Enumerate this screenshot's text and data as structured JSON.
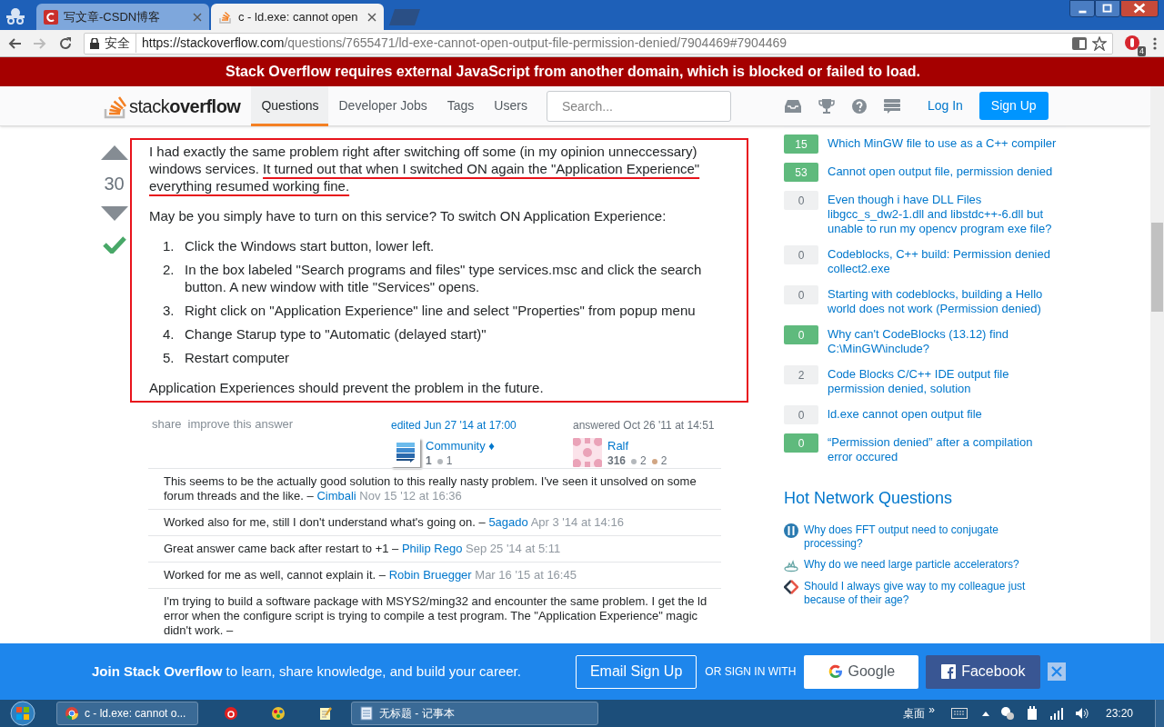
{
  "browser": {
    "tabs": [
      {
        "title": "写文章-CSDN博客",
        "selected": false,
        "kind": "csdn"
      },
      {
        "title": "c - ld.exe: cannot open",
        "selected": true,
        "kind": "so"
      }
    ],
    "address": {
      "secure_label": "安全",
      "host": "https://stackoverflow.com",
      "path": "/questions/7655471/ld-exe-cannot-open-output-file-permission-denied/7904469#7904469"
    },
    "extension_badge": "4"
  },
  "js_warning": "Stack Overflow requires external JavaScript from another domain, which is blocked or failed to load.",
  "header": {
    "logo": {
      "light": "stack",
      "bold": "overflow"
    },
    "nav": [
      {
        "label": "Questions",
        "selected": true
      },
      {
        "label": "Developer Jobs",
        "selected": false
      },
      {
        "label": "Tags",
        "selected": false
      },
      {
        "label": "Users",
        "selected": false
      }
    ],
    "search": {
      "placeholder": "Search..."
    },
    "login": "Log In",
    "signup": "Sign Up"
  },
  "answer": {
    "votes": "30",
    "accepted": true,
    "intro": [
      {
        "text": "I had exactly the same problem right after switching off some (in my opinion unneccessary) windows services. ",
        "underlined": false
      },
      {
        "text": "It turned out that when I switched ON again the \"Application Experience\" everything resumed working fine.",
        "underlined": true
      }
    ],
    "question": "May be you simply have to turn on this service? To switch ON Application Experience:",
    "steps": [
      {
        "number": "1.",
        "text": "Click the Windows start button, lower left."
      },
      {
        "number": "2.",
        "text": "In the box labeled \"Search programs and files\" type services.msc and click the search button. A new window with title \"Services\" opens."
      },
      {
        "number": "3.",
        "text": "Right click on \"Application Experience\" line and select \"Properties\" from popup menu"
      },
      {
        "number": "4.",
        "text": "Change Starup type to \"Automatic (delayed start)\""
      },
      {
        "number": "5.",
        "text": "Restart computer"
      }
    ],
    "closing": "Application Experiences should prevent the problem in the future.",
    "links": [
      "share",
      "improve this answer"
    ],
    "edited": {
      "label": "edited Jun 27 '14 at 17:00",
      "user": "Community ♦",
      "rep": "1",
      "badges": [
        {
          "count": "1",
          "color": "#b4b8bc"
        }
      ],
      "avatar": {
        "kind": "community"
      }
    },
    "answered": {
      "label": "answered Oct 26 '11 at 14:51",
      "user": "Ralf",
      "rep": "316",
      "badges": [
        {
          "count": "2",
          "color": "#b4b8bc"
        },
        {
          "count": "2",
          "color": "#d1a684"
        }
      ],
      "avatar": {
        "kind": "pattern"
      }
    }
  },
  "comments": [
    {
      "text": "This seems to be the actually good solution to this really nasty problem. I've seen it unsolved on some forum threads and the like. –",
      "user": "Cimbali",
      "date": "Nov 15 '12 at 16:36"
    },
    {
      "text": "Worked also for me, still I don't understand what's going on. –",
      "user": "5agado",
      "date": "Apr 3 '14 at 14:16"
    },
    {
      "text": "Great answer came back after restart to +1 –",
      "user": "Philip Rego",
      "date": "Sep 25 '14 at 5:11"
    },
    {
      "text": "Worked for me as well, cannot explain it. –",
      "user": "Robin Bruegger",
      "date": "Mar 16 '15 at 16:45"
    },
    {
      "text": "I'm trying to build a software package with MSYS2/ming32 and encounter the same problem. I get the ld error when the configure script is trying to compile a test program. The \"Application Experience\" magic didn't work. –"
    }
  ],
  "related": [
    {
      "score": "15",
      "accepted": true,
      "title": "Which MinGW file to use as a C++ compiler"
    },
    {
      "score": "53",
      "accepted": true,
      "title": "Cannot open output file, permission denied"
    },
    {
      "score": "0",
      "accepted": false,
      "title": "Even though i have DLL Files libgcc_s_dw2-1.dll and libstdc++-6.dll but unable to run my opencv program exe file?"
    },
    {
      "score": "0",
      "accepted": false,
      "title": "Codeblocks, C++ build: Permission denied collect2.exe"
    },
    {
      "score": "0",
      "accepted": false,
      "title": "Starting with codeblocks, building a Hello world does not work (Permission denied)"
    },
    {
      "score": "0",
      "accepted": true,
      "title": "Why can't CodeBlocks (13.12) find C:\\MinGW\\include?"
    },
    {
      "score": "2",
      "accepted": false,
      "title": "Code Blocks C/C++ IDE output file permission denied, solution"
    },
    {
      "score": "0",
      "accepted": false,
      "title": "ld.exe cannot open output file"
    },
    {
      "score": "0",
      "accepted": true,
      "title": "“Permission denied” after a compilation error occured"
    }
  ],
  "hot": {
    "title": "Hot Network Questions",
    "items": [
      {
        "kind": "dsp",
        "title": "Why does FFT output need to conjugate processing?"
      },
      {
        "kind": "physics",
        "title": "Why do we need large particle accelerators?"
      },
      {
        "kind": "workplace",
        "title": "Should I always give way to my colleague just because of their age?"
      }
    ]
  },
  "banner": {
    "text": "**Join Stack Overflow** to learn, share knowledge, and build your career.",
    "email": "Email Sign Up",
    "or": "OR SIGN IN WITH",
    "google": "Google",
    "facebook": "Facebook"
  },
  "taskbar": {
    "items": [
      {
        "kind": "chrome",
        "title": "c - ld.exe: cannot o..."
      },
      {
        "kind": "netease"
      },
      {
        "kind": "paint"
      },
      {
        "kind": "notes"
      },
      {
        "kind": "notepad",
        "title": "无标题 - 记事本"
      }
    ],
    "desktop": "桌面",
    "overflow": "»",
    "time": "23:20"
  }
}
